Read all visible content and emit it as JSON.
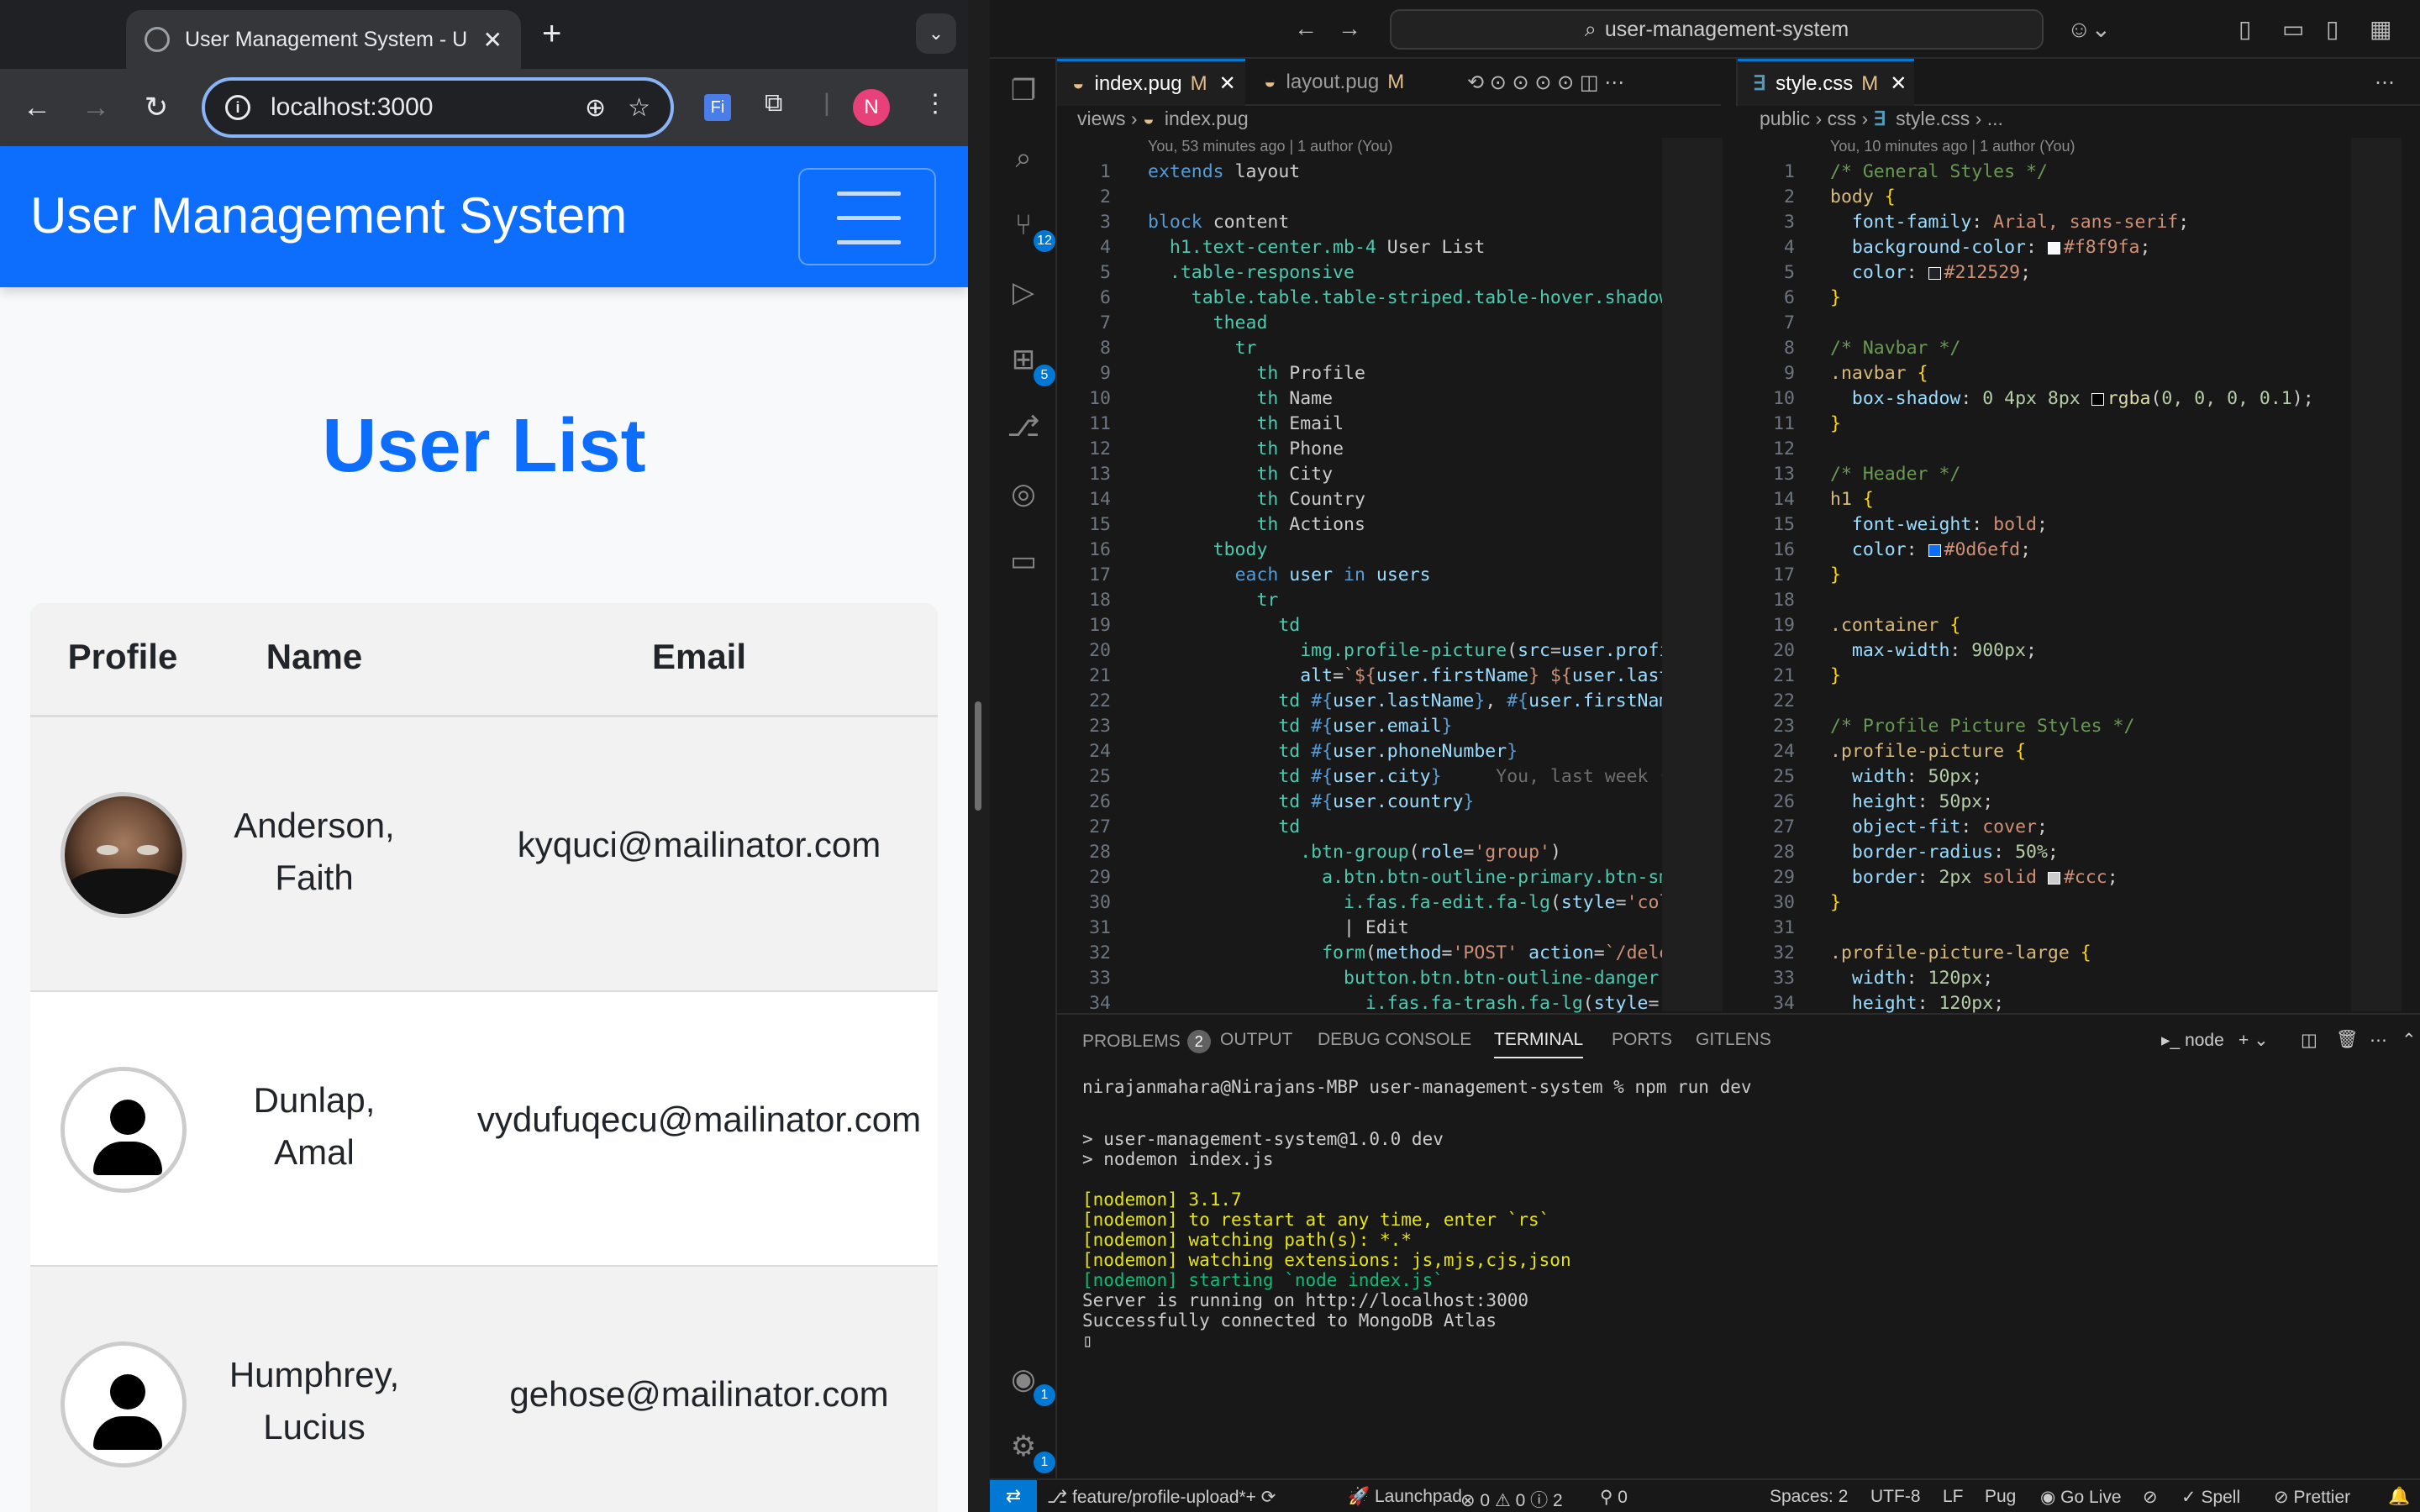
{
  "browser": {
    "tab_title": "User Management System - U",
    "url": "localhost:3000",
    "profile_initial": "N",
    "navbar_brand": "User Management System",
    "page_title": "User List",
    "table_headers": [
      "Profile",
      "Name",
      "Email"
    ],
    "users": [
      {
        "name_line1": "Anderson,",
        "name_line2": "Faith",
        "email": "kyquci@mailinator.com",
        "avatar": "photo"
      },
      {
        "name_line1": "Dunlap,",
        "name_line2": "Amal",
        "email": "vydufuqecu@mailinator.com",
        "avatar": "default-person-icon"
      },
      {
        "name_line1": "Humphrey,",
        "name_line2": "Lucius",
        "email": "gehose@mailinator.com",
        "avatar": "default-person-icon"
      }
    ],
    "colors": {
      "primary": "#0d6efd",
      "chrome_dark": "#202124"
    }
  },
  "vscode": {
    "command_center": "user-management-system",
    "activity_badges": {
      "source_control": "12",
      "extensions": "5",
      "accounts": "1",
      "manage": "1"
    },
    "left_group": {
      "tabs": [
        {
          "label": "index.pug",
          "modified": "M"
        },
        {
          "label": "layout.pug",
          "modified": "M"
        }
      ],
      "breadcrumb": [
        "views",
        "index.pug"
      ],
      "blame": "You, 53 minutes ago | 1 author (You)",
      "inline_blame": "You, last week • f"
    },
    "right_group": {
      "tabs": [
        {
          "label": "style.css",
          "modified": "M"
        }
      ],
      "breadcrumb": [
        "public",
        "css",
        "style.css",
        "..."
      ],
      "blame": "You, 10 minutes ago | 1 author (You)"
    },
    "panel": {
      "tabs": [
        "PROBLEMS",
        "OUTPUT",
        "DEBUG CONSOLE",
        "TERMINAL",
        "PORTS",
        "GITLENS"
      ],
      "problems_count": "2",
      "terminal_name": "node",
      "terminal_lines": [
        "nirajanmahara@Nirajans-MBP user-management-system % npm run dev",
        "",
        "> user-management-system@1.0.0 dev",
        "> nodemon index.js",
        "",
        "[nodemon] 3.1.7",
        "[nodemon] to restart at any time, enter `rs`",
        "[nodemon] watching path(s): *.*",
        "[nodemon] watching extensions: js,mjs,cjs,json",
        "[nodemon] starting `node index.js`",
        "Server is running on http://localhost:3000",
        "Successfully connected to MongoDB Atlas"
      ]
    },
    "status_bar": {
      "branch": "feature/profile-upload*+",
      "launchpad": "Launchpad",
      "problems": "⊗ 0 ⚠ 0 ⓘ 2",
      "ports": "⚲ 0",
      "spaces": "Spaces: 2",
      "encoding": "UTF-8",
      "eol": "LF",
      "language": "Pug",
      "golive": "Go Live",
      "spell": "Spell",
      "prettier": "Prettier"
    }
  }
}
